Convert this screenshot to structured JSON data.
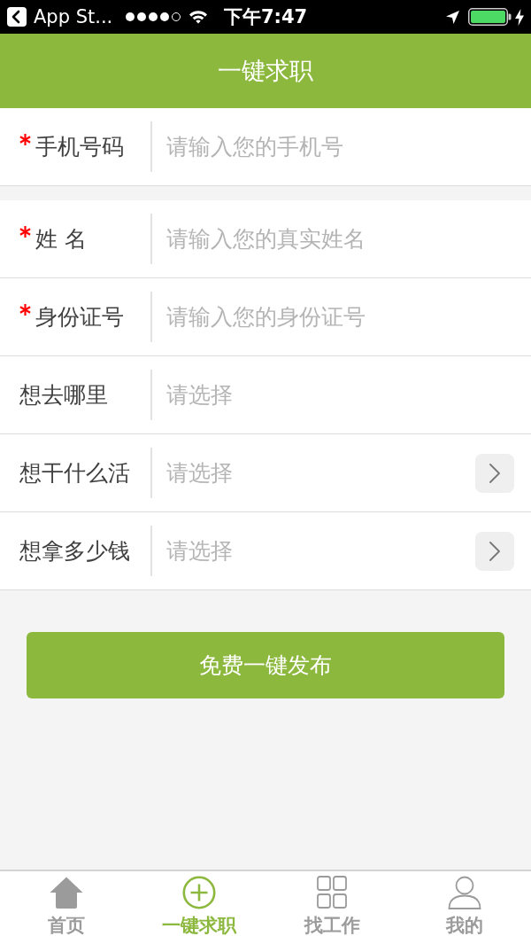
{
  "status_bar": {
    "back_label": "App St...",
    "time": "下午7:47"
  },
  "header": {
    "title": "一键求职"
  },
  "form": {
    "groups": [
      {
        "fields": [
          {
            "label": "手机号码",
            "required": true,
            "placeholder": "请输入您的手机号",
            "chevron": false
          }
        ]
      },
      {
        "fields": [
          {
            "label": "姓 名",
            "required": true,
            "placeholder": "请输入您的真实姓名",
            "chevron": false
          },
          {
            "label": "身份证号",
            "required": true,
            "placeholder": "请输入您的身份证号",
            "chevron": false
          },
          {
            "label": "想去哪里",
            "required": false,
            "placeholder": "请选择",
            "chevron": false
          },
          {
            "label": "想干什么活",
            "required": false,
            "placeholder": "请选择",
            "chevron": true
          },
          {
            "label": "想拿多少钱",
            "required": false,
            "placeholder": "请选择",
            "chevron": true
          }
        ]
      }
    ]
  },
  "submit_button": {
    "label": "免费一键发布"
  },
  "tab_bar": {
    "tabs": [
      {
        "label": "首页",
        "selected": false
      },
      {
        "label": "一键求职",
        "selected": true
      },
      {
        "label": "找工作",
        "selected": false
      },
      {
        "label": "我的",
        "selected": false
      }
    ]
  }
}
